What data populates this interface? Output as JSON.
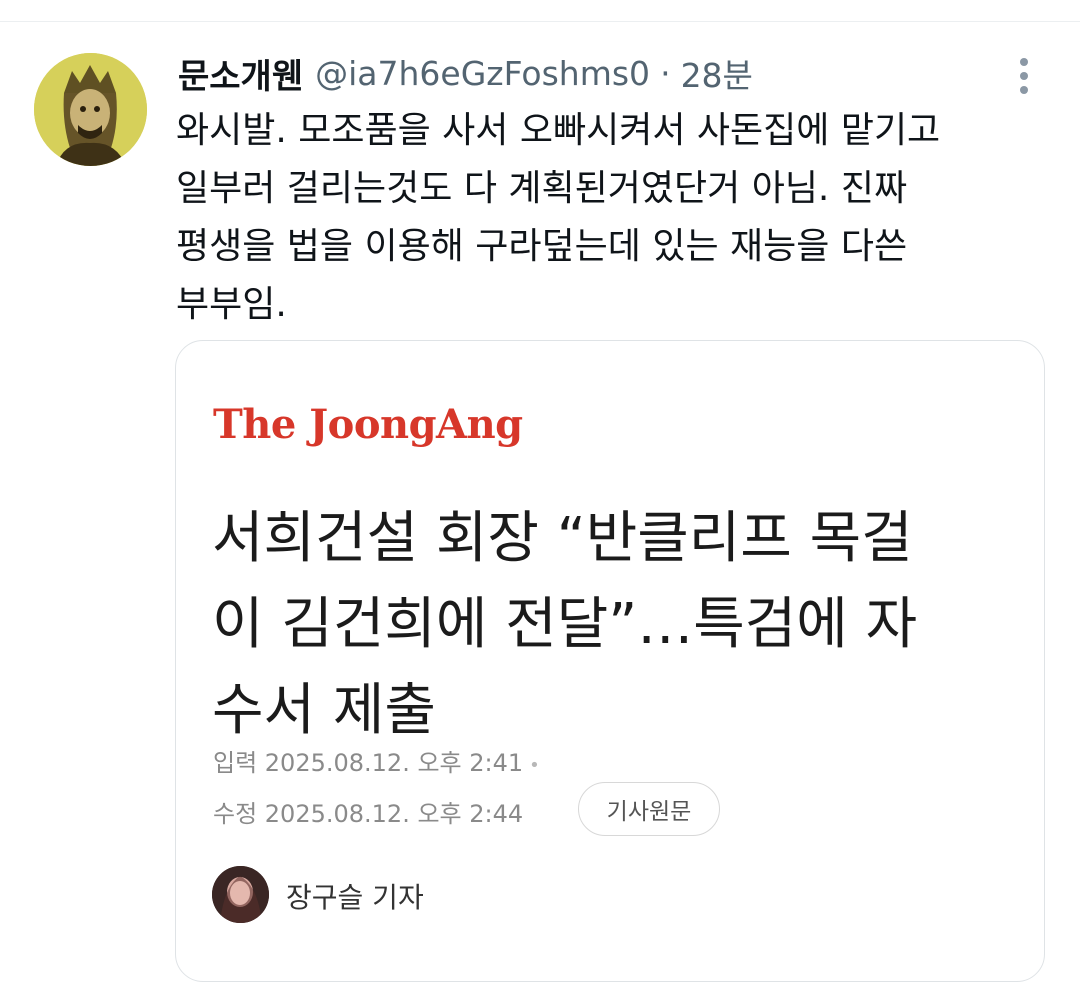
{
  "tweet": {
    "display_name": "문소개웬",
    "handle": "@ia7h6eGzFoshms0",
    "separator": "·",
    "time": "28분",
    "more_icon": "more-vertical-icon",
    "text_lines": [
      "와시발. 모조품을 사서 오빠시켜서 사돈집에 맡기고",
      "일부러 걸리는것도 다 계획된거였단거 아님. 진짜",
      "평생을 법을 이용해 구라덮는데 있는 재능을 다쓴",
      "부부임."
    ]
  },
  "article_card": {
    "publisher": "The JoongAng",
    "headline_lines": [
      "서희건설 회장 “반클리프 목걸",
      "이 김건희에 전달”…특검에 자",
      "수서 제출"
    ],
    "published": "입력 2025.08.12. 오후 2:41",
    "published_dot": "•",
    "modified": "수정 2025.08.12. 오후 2:44",
    "original_button": "기사원문",
    "reporter": "장구슬 기자"
  },
  "colors": {
    "publisher_red": "#d7372a",
    "secondary_text": "#536471",
    "avatar_bg": "#d6d05a"
  }
}
